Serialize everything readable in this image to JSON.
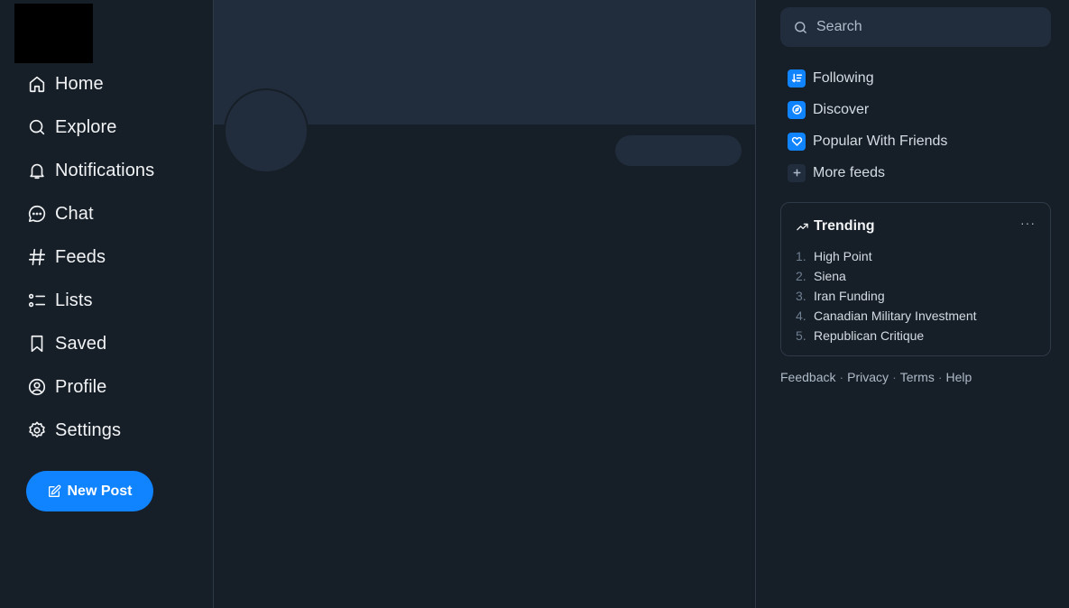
{
  "nav": {
    "items": [
      {
        "label": "Home",
        "icon": "home-icon"
      },
      {
        "label": "Explore",
        "icon": "search-icon"
      },
      {
        "label": "Notifications",
        "icon": "bell-icon"
      },
      {
        "label": "Chat",
        "icon": "chat-icon"
      },
      {
        "label": "Feeds",
        "icon": "hash-icon"
      },
      {
        "label": "Lists",
        "icon": "list-icon"
      },
      {
        "label": "Saved",
        "icon": "bookmark-icon"
      },
      {
        "label": "Profile",
        "icon": "user-circle-icon"
      },
      {
        "label": "Settings",
        "icon": "gear-icon"
      }
    ],
    "new_post_label": "New Post"
  },
  "search": {
    "placeholder": "Search"
  },
  "feeds": [
    {
      "label": "Following",
      "icon": "sort-icon"
    },
    {
      "label": "Discover",
      "icon": "discover-icon"
    },
    {
      "label": "Popular With Friends",
      "icon": "heart-icon"
    },
    {
      "label": "More feeds",
      "icon": "plus-icon"
    }
  ],
  "trending": {
    "title": "Trending",
    "more": "···",
    "items": [
      {
        "num": "1.",
        "label": "High Point"
      },
      {
        "num": "2.",
        "label": "Siena"
      },
      {
        "num": "3.",
        "label": "Iran Funding"
      },
      {
        "num": "4.",
        "label": "Canadian Military Investment"
      },
      {
        "num": "5.",
        "label": "Republican Critique"
      }
    ]
  },
  "footer": {
    "links": [
      "Feedback",
      "Privacy",
      "Terms",
      "Help"
    ],
    "separator": "·"
  },
  "colors": {
    "background": "#161e27",
    "surface": "#212d3c",
    "accent": "#1083fe",
    "border": "#2e3a48"
  }
}
